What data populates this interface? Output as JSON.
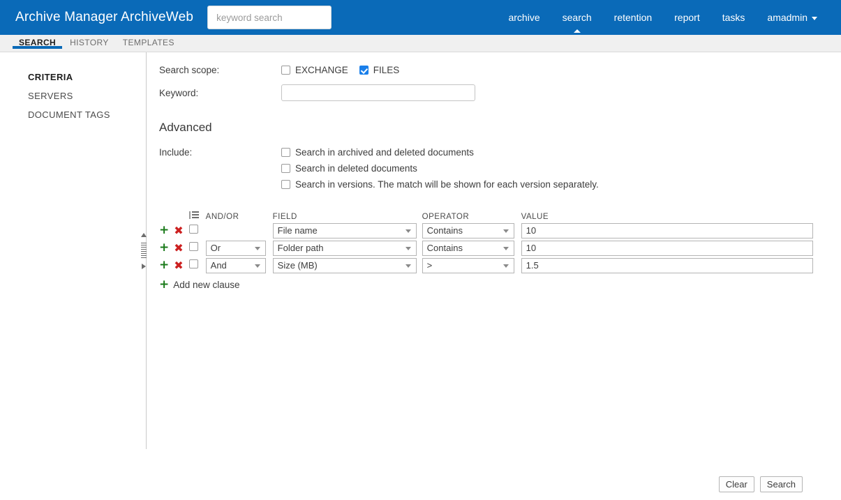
{
  "header": {
    "brand": "Archive Manager ArchiveWeb",
    "search_placeholder": "keyword search",
    "search_value": "",
    "nav": [
      {
        "label": "archive",
        "active": false
      },
      {
        "label": "search",
        "active": true
      },
      {
        "label": "retention",
        "active": false
      },
      {
        "label": "report",
        "active": false
      },
      {
        "label": "tasks",
        "active": false
      }
    ],
    "user": "amadmin"
  },
  "tabs": [
    {
      "label": "SEARCH",
      "active": true
    },
    {
      "label": "HISTORY",
      "active": false
    },
    {
      "label": "TEMPLATES",
      "active": false
    }
  ],
  "sidebar": {
    "items": [
      {
        "label": "CRITERIA",
        "active": true
      },
      {
        "label": "SERVERS",
        "active": false
      },
      {
        "label": "DOCUMENT TAGS",
        "active": false
      }
    ]
  },
  "form": {
    "scope_label": "Search scope:",
    "scope_options": [
      {
        "label": "EXCHANGE",
        "checked": false
      },
      {
        "label": "FILES",
        "checked": true
      }
    ],
    "keyword_label": "Keyword:",
    "keyword_value": "",
    "keyword_placeholder": "",
    "advanced_title": "Advanced",
    "include_label": "Include:",
    "include_options": [
      {
        "label": "Search in archived and deleted documents",
        "checked": false
      },
      {
        "label": "Search in deleted documents",
        "checked": false
      },
      {
        "label": "Search in versions. The match will be shown for each version separately.",
        "checked": false
      }
    ]
  },
  "criteria": {
    "columns": {
      "andor": "AND/OR",
      "field": "FIELD",
      "operator": "OPERATOR",
      "value": "VALUE"
    },
    "select_all_icon": "list-icon",
    "add_icon": "+",
    "remove_icon": "✖",
    "rows": [
      {
        "selected": false,
        "andor": "",
        "field": "File name",
        "operator": "Contains",
        "value": "10"
      },
      {
        "selected": false,
        "andor": "Or",
        "field": "Folder path",
        "operator": "Contains",
        "value": "10"
      },
      {
        "selected": false,
        "andor": "And",
        "field": "Size (MB)",
        "operator": ">",
        "value": "1.5"
      }
    ],
    "add_new_clause": "Add new clause"
  },
  "footer": {
    "clear_label": "Clear",
    "search_label": "Search"
  },
  "colors": {
    "brand_blue": "#0a6ab8",
    "accent_blue": "#1a7fea",
    "add_green": "#1a7a1a",
    "remove_red": "#cc2020"
  }
}
